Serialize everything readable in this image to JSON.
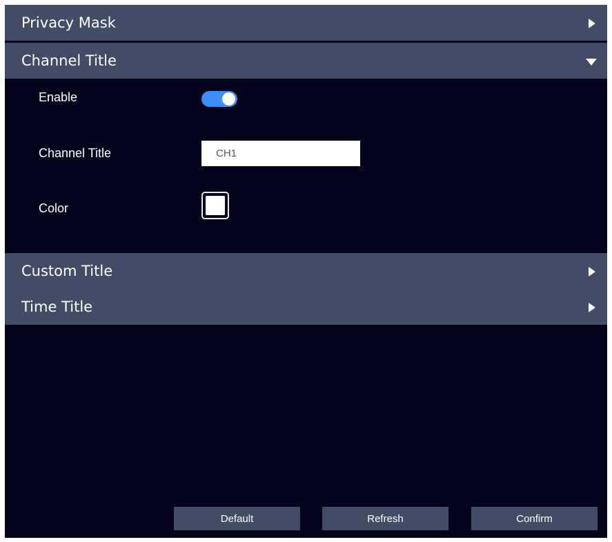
{
  "sections": {
    "privacy_mask": {
      "title": "Privacy Mask",
      "expanded": false
    },
    "channel_title": {
      "title": "Channel Title",
      "expanded": true
    },
    "custom_title": {
      "title": "Custom Title",
      "expanded": false
    },
    "time_title": {
      "title": "Time Title",
      "expanded": false
    }
  },
  "channel_title_settings": {
    "enable_label": "Enable",
    "enable_on": true,
    "channel_title_label": "Channel Title",
    "channel_title_value": "CH1",
    "color_label": "Color",
    "color_value": "#ffffff"
  },
  "buttons": {
    "default_label": "Default",
    "refresh_label": "Refresh",
    "confirm_label": "Confirm"
  },
  "colors": {
    "background": "#03041c",
    "header": "#434c66",
    "toggle_on": "#3e8ef7",
    "text": "#ffffff"
  }
}
